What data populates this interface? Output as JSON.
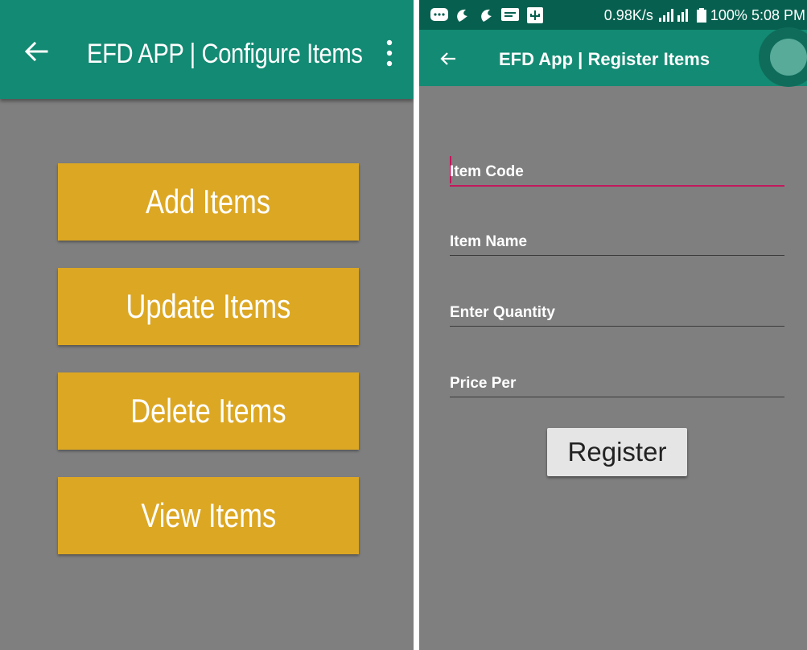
{
  "configure_screen": {
    "title": "EFD APP | Configure Items",
    "buttons": [
      {
        "label": "Add Items"
      },
      {
        "label": "Update Items"
      },
      {
        "label": "Delete Items"
      },
      {
        "label": "View Items"
      }
    ]
  },
  "register_screen": {
    "status_bar": {
      "network_speed": "0.98K/s",
      "battery": "100%",
      "time": "5:08 PM"
    },
    "title": "EFD App | Register Items",
    "fields": [
      {
        "label": "Item Code"
      },
      {
        "label": "Item Name"
      },
      {
        "label": "Enter Quantity"
      },
      {
        "label": "Price Per"
      }
    ],
    "register_label": "Register"
  },
  "colors": {
    "toolbar": "#138a73",
    "status_bar": "#07604f",
    "background": "#7f7f7f",
    "button_gold": "#dca723",
    "accent_pink": "#c2185b"
  },
  "icons": [
    "back-arrow-icon",
    "more-vert-icon",
    "notification-icons",
    "signal-icon",
    "battery-icon"
  ]
}
